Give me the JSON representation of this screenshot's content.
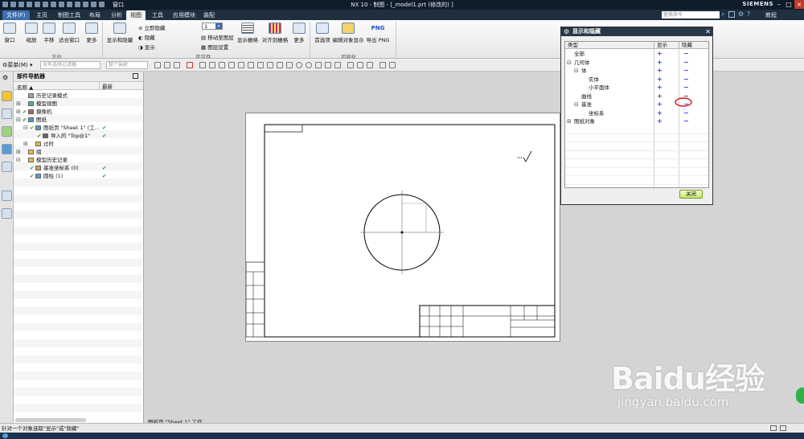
{
  "window": {
    "title": "NX 10 - 制图 - [_model1.prt (修改的) ]",
    "brand": "SIEMENS",
    "help": "教程"
  },
  "menu": {
    "file": "文件(F)",
    "tabs": [
      "主页",
      "制图工具",
      "布局",
      "分析",
      "视图",
      "工具",
      "应用模块",
      "装配"
    ],
    "active_tab": "视图",
    "search_placeholder": "查找命令",
    "window_dropdown": "窗口"
  },
  "ribbon": {
    "buttons": {
      "window": "窗口",
      "zoom": "缩放",
      "pan": "平移",
      "fit_window": "适合窗口",
      "more1": "更多",
      "show_hide": "显示和隐藏",
      "immediate_hide": "立即隐藏",
      "hide": "隐藏",
      "show": "显示",
      "layer_value": "1",
      "move_to_layer": "移动至图层",
      "layer_settings": "图层设置",
      "show_grid": "显示栅格",
      "snap_to_grid": "对齐到栅格",
      "more2": "更多",
      "preferences": "首选项",
      "edit_object_display": "编辑对象显示",
      "export_png": "导出 PNG",
      "png": "PNG"
    },
    "groups": {
      "orient": "方位",
      "visibility": "可见性",
      "visualization": "可视化"
    }
  },
  "cmdbar": {
    "menu": "菜单(M)",
    "filter_placeholder": "没有选择过滤器",
    "scope_placeholder": "整个装配"
  },
  "navigator": {
    "title": "部件导航器",
    "col_name": "名称",
    "col_latest": "最新",
    "items": [
      {
        "label": "历史记录模式",
        "latest": ""
      },
      {
        "label": "模型视图",
        "latest": ""
      },
      {
        "label": "摄像机",
        "latest": ""
      },
      {
        "label": "图纸",
        "latest": ""
      },
      {
        "label": "图纸页 \"Sheet 1\" (工...",
        "latest": "✔"
      },
      {
        "label": "导入的 \"Top@1\"",
        "latest": "✔"
      },
      {
        "label": "过时",
        "latest": ""
      },
      {
        "label": "组",
        "latest": ""
      },
      {
        "label": "模型历史记录",
        "latest": ""
      },
      {
        "label": "基准坐标系 (0)",
        "latest": "✔"
      },
      {
        "label": "圆柱 (1)",
        "latest": "✔"
      }
    ]
  },
  "drawing": {
    "sheet_label": "图纸页 \"Sheet 1\" 工作"
  },
  "dialog": {
    "title": "显示和隐藏",
    "col_type": "类型",
    "col_show": "显示",
    "col_hide": "隐藏",
    "rows": [
      {
        "label": "全部",
        "level": 0
      },
      {
        "label": "几何体",
        "level": 0
      },
      {
        "label": "体",
        "level": 1
      },
      {
        "label": "实体",
        "level": 2
      },
      {
        "label": "小平面体",
        "level": 2
      },
      {
        "label": "曲线",
        "level": 1
      },
      {
        "label": "基准",
        "level": 1
      },
      {
        "label": "坐标系",
        "level": 2
      },
      {
        "label": "图纸对象",
        "level": 0
      }
    ],
    "plus": "+",
    "minus": "−",
    "close": "关闭"
  },
  "status": {
    "prompt": "针对一个对象选取\"显示\"或\"隐藏\""
  },
  "watermark": {
    "brand": "Baidu经验",
    "url": "jingyan.baidu.com"
  },
  "colors": {
    "titlebar": "#0f1c2a",
    "menubar": "#1f2f3f",
    "accent": "#3a6fb0",
    "plus_minus": "#1f4fcf",
    "highlight_circle": "#e01010",
    "check": "#1a9a1a"
  }
}
